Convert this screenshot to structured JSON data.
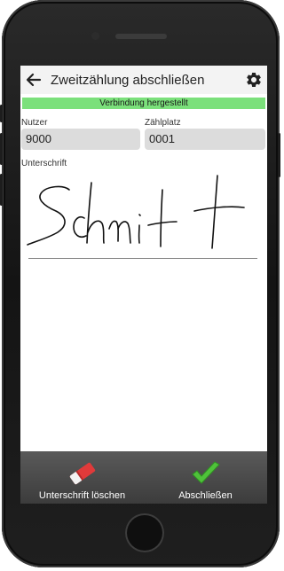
{
  "appbar": {
    "title": "Zweitzählung abschließen",
    "back_icon": "arrow-left-icon",
    "settings_icon": "gear-icon"
  },
  "status": {
    "text": "Verbindung hergestellt",
    "color": "#7be07b"
  },
  "fields": {
    "user_label": "Nutzer",
    "user_value": "9000",
    "counter_label": "Zählplatz",
    "counter_value": "0001"
  },
  "signature": {
    "label": "Unterschrift",
    "handwritten": "Schmitt"
  },
  "bottom_bar": {
    "clear_label": "Unterschrift löschen",
    "clear_icon": "eraser-icon",
    "finish_label": "Abschließen",
    "finish_icon": "checkmark-icon"
  }
}
